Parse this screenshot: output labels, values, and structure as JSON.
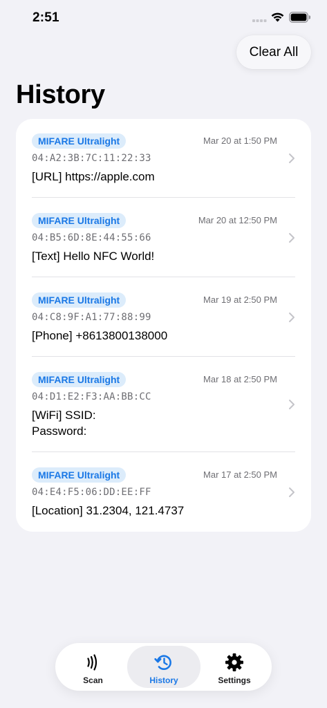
{
  "status_bar": {
    "time": "2:51"
  },
  "header": {
    "clear_all_label": "Clear All",
    "title": "History"
  },
  "colors": {
    "accent": "#1a78e6",
    "badge_bg": "#dcecfb",
    "background": "#f2f2f7"
  },
  "history": [
    {
      "tag_type": "MIFARE Ultralight",
      "date": "Mar 20 at 1:50 PM",
      "uid": "04:A2:3B:7C:11:22:33",
      "content": "[URL] https://apple.com"
    },
    {
      "tag_type": "MIFARE Ultralight",
      "date": "Mar 20 at 12:50 PM",
      "uid": "04:B5:6D:8E:44:55:66",
      "content": "[Text] Hello NFC World!"
    },
    {
      "tag_type": "MIFARE Ultralight",
      "date": "Mar 19 at 2:50 PM",
      "uid": "04:C8:9F:A1:77:88:99",
      "content": "[Phone] +8613800138000"
    },
    {
      "tag_type": "MIFARE Ultralight",
      "date": "Mar 18 at 2:50 PM",
      "uid": "04:D1:E2:F3:AA:BB:CC",
      "content": "[WiFi] SSID:\nPassword:"
    },
    {
      "tag_type": "MIFARE Ultralight",
      "date": "Mar 17 at 2:50 PM",
      "uid": "04:E4:F5:06:DD:EE:FF",
      "content": "[Location] 31.2304, 121.4737"
    }
  ],
  "tab_bar": {
    "scan": {
      "label": "Scan",
      "icon": "nfc-waves-icon"
    },
    "history": {
      "label": "History",
      "icon": "history-clock-icon",
      "selected": true
    },
    "settings": {
      "label": "Settings",
      "icon": "gear-icon"
    }
  }
}
